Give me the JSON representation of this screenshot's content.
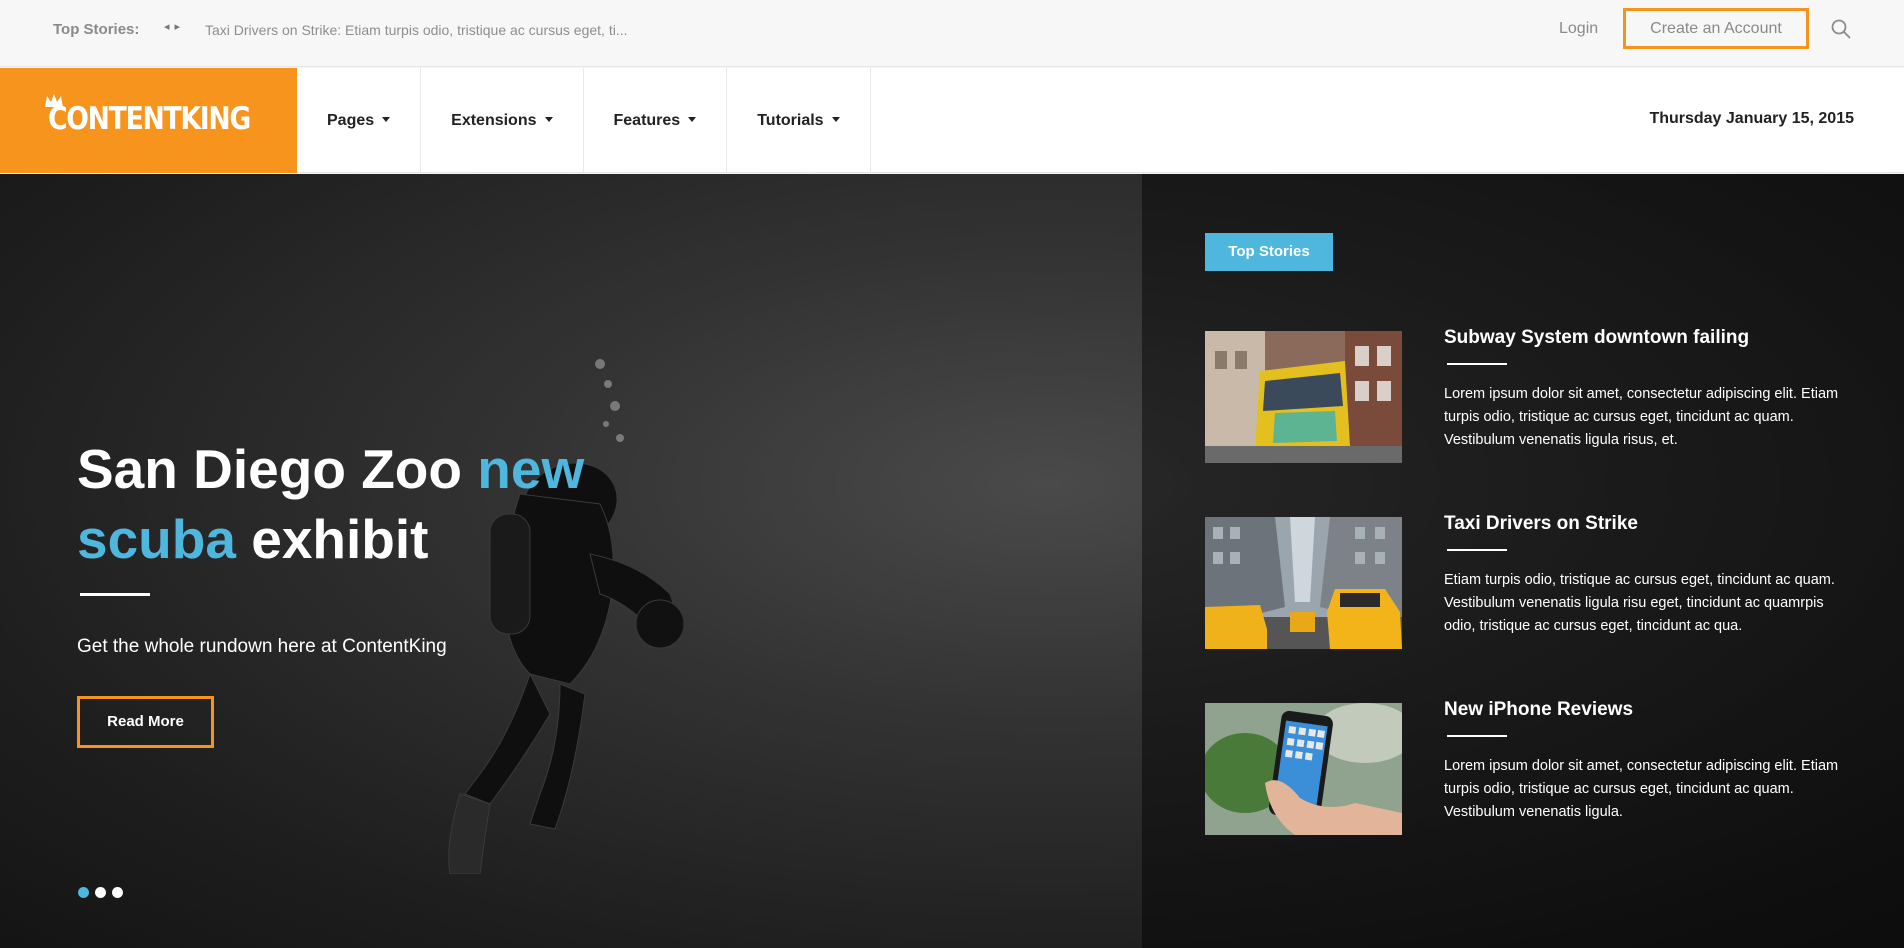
{
  "topbar": {
    "label": "Top Stories:",
    "headline": "Taxi Drivers on Strike: Etiam turpis odio, tristique ac cursus eget, ti...",
    "login": "Login",
    "create_account": "Create an Account"
  },
  "nav": {
    "logo_text": "CONTENTKING",
    "items": [
      {
        "label": "Pages"
      },
      {
        "label": "Extensions"
      },
      {
        "label": "Features"
      },
      {
        "label": "Tutorials"
      }
    ],
    "date": "Thursday January 15, 2015"
  },
  "hero": {
    "title_part1": "San Diego Zoo ",
    "title_accent1": "new",
    "title_accent2": "scuba",
    "title_part2": " exhibit",
    "subtitle": "Get the whole rundown here at ContentKing",
    "read_more": "Read More",
    "slide_count": 3,
    "active_slide": 1
  },
  "top_stories": {
    "badge": "Top Stories",
    "items": [
      {
        "title": "Subway System downtown failing",
        "text": "Lorem ipsum dolor sit amet, consectetur adipiscing elit. Etiam turpis odio, tristique ac cursus eget, tincidunt ac quam. Vestibulum venenatis ligula risus, et."
      },
      {
        "title": "Taxi Drivers on Strike",
        "text": "Etiam turpis odio, tristique ac cursus eget, tincidunt ac quam. Vestibulum venenatis ligula risu eget, tincidunt ac quamrpis odio, tristique ac cursus eget, tincidunt ac qua."
      },
      {
        "title": "New iPhone Reviews",
        "text": "Lorem ipsum dolor sit amet, consectetur adipiscing elit. Etiam turpis odio, tristique ac cursus eget, tincidunt ac quam. Vestibulum venenatis ligula."
      }
    ]
  },
  "colors": {
    "brand_orange": "#f7941d",
    "accent_blue": "#4fb6dd"
  },
  "icons": {
    "search": "search-icon",
    "prev": "chevron-left-icon",
    "next": "chevron-right-icon",
    "crown": "crown-icon"
  }
}
